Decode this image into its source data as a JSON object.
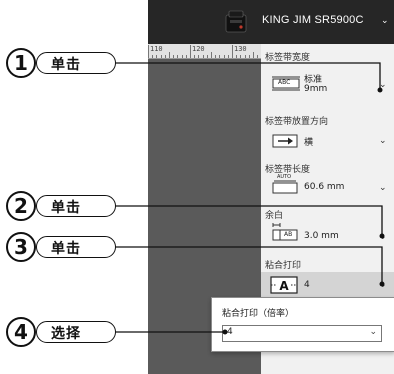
{
  "header": {
    "printer_name": "KING JIM SR5900C",
    "chevron": "⌄"
  },
  "ruler": {
    "labels": [
      "110",
      "120",
      "130"
    ]
  },
  "settings": {
    "tape_width": {
      "label": "标签带宽度",
      "icon_text": "ABC",
      "value_line1": "标准",
      "value_line2": "9mm"
    },
    "tape_orientation": {
      "label": "标签带放置方向",
      "value": "横"
    },
    "tape_length": {
      "label": "标签带长度",
      "icon_text": "AUTO",
      "value": "60.6 mm"
    },
    "margin": {
      "label": "余白",
      "icon_text": "AB",
      "value": "3.0 mm"
    },
    "merge_print": {
      "label": "粘合打印",
      "value": "4"
    }
  },
  "popup": {
    "title": "粘合打印（倍率）",
    "selected": "4"
  },
  "callouts": [
    {
      "num": "1",
      "text": "单击"
    },
    {
      "num": "2",
      "text": "单击"
    },
    {
      "num": "3",
      "text": "单击"
    },
    {
      "num": "4",
      "text": "选择"
    }
  ]
}
